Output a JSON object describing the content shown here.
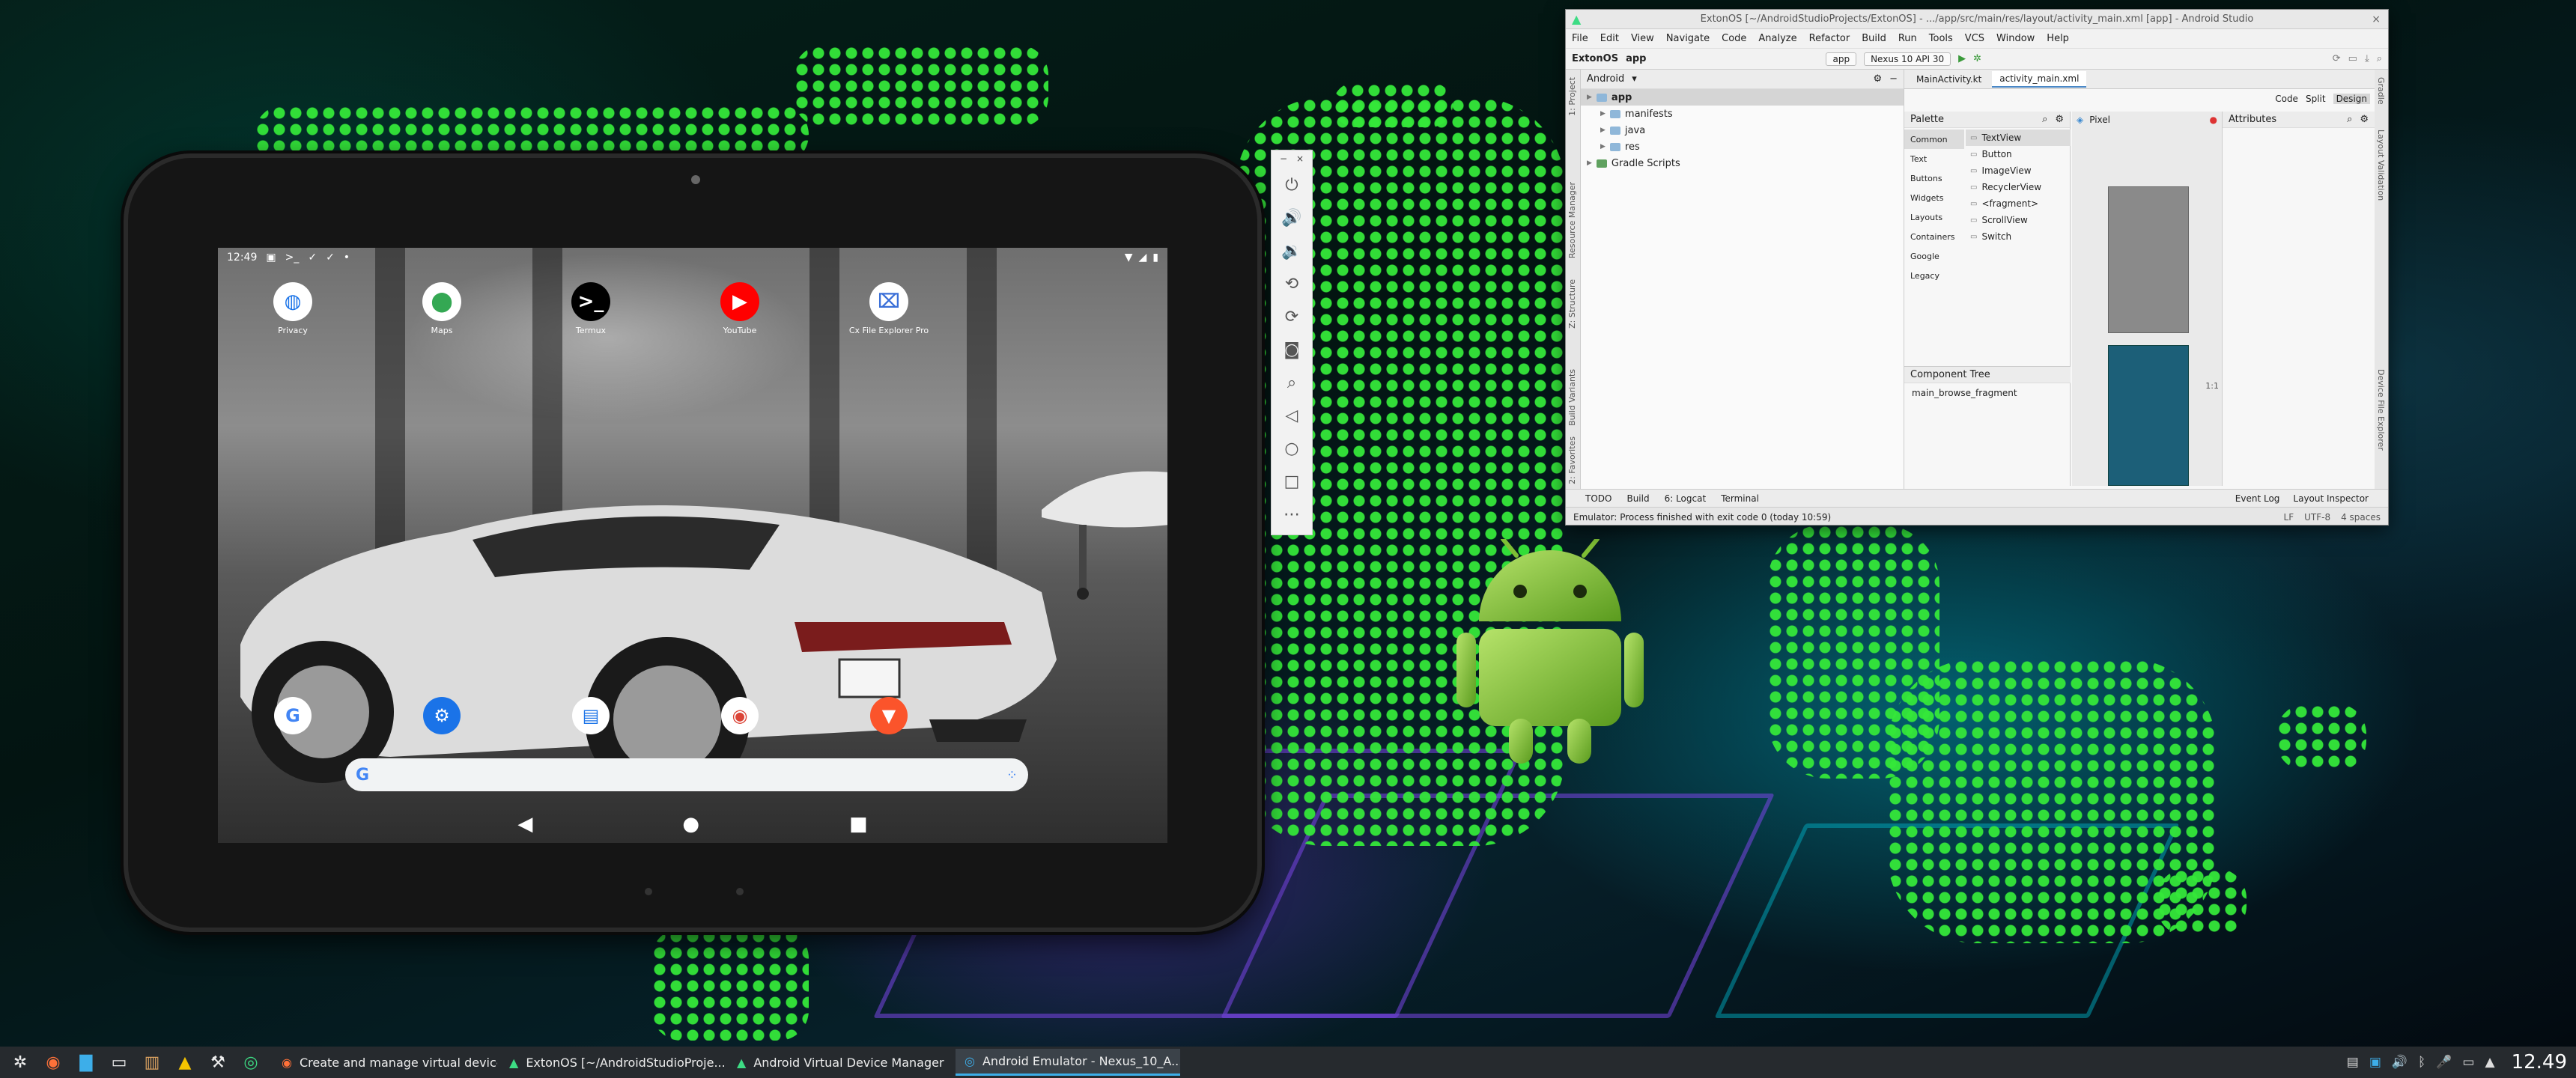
{
  "tablet": {
    "status": {
      "time": "12:49"
    },
    "apps": [
      {
        "label": "Privacy",
        "icon": "privacy-globe-icon",
        "glyph": "◍",
        "bg": "#ffffff",
        "fg": "#1a73e8"
      },
      {
        "label": "Maps",
        "icon": "maps-pin-icon",
        "glyph": "⬤",
        "bg": "#ffffff",
        "fg": "#34a853"
      },
      {
        "label": "Termux",
        "icon": "termux-terminal-icon",
        "glyph": ">_",
        "bg": "#000000",
        "fg": "#ffffff"
      },
      {
        "label": "YouTube",
        "icon": "youtube-play-icon",
        "glyph": "▶",
        "bg": "#ff0000",
        "fg": "#ffffff"
      },
      {
        "label": "Cx File Explorer Pro",
        "icon": "file-explorer-icon",
        "glyph": "⌧",
        "bg": "#ffffff",
        "fg": "#3a6fd8"
      }
    ],
    "dock": [
      {
        "icon": "google-g-icon",
        "glyph": "G",
        "bg": "#ffffff",
        "fg": "#4285f4"
      },
      {
        "icon": "settings-gear-icon",
        "glyph": "⚙",
        "bg": "#1a73e8",
        "fg": "#ffffff"
      },
      {
        "icon": "files-icon",
        "glyph": "▤",
        "bg": "#ffffff",
        "fg": "#1a73e8"
      },
      {
        "icon": "chrome-icon",
        "glyph": "◉",
        "bg": "#ffffff",
        "fg": "#db4437"
      },
      {
        "icon": "brave-browser-icon",
        "glyph": "▼",
        "bg": "#fb542b",
        "fg": "#ffffff"
      }
    ],
    "search": {
      "g_letter": "G"
    }
  },
  "emulator_toolbar": {
    "close": "×",
    "minimize": "−",
    "more": "⋯"
  },
  "studio": {
    "title": "ExtonOS [~/AndroidStudioProjects/ExtonOS] - .../app/src/main/res/layout/activity_main.xml [app] - Android Studio",
    "menu": [
      "File",
      "Edit",
      "View",
      "Navigate",
      "Code",
      "Analyze",
      "Refactor",
      "Build",
      "Run",
      "Tools",
      "VCS",
      "Window",
      "Help"
    ],
    "breadcrumb": [
      "ExtonOS",
      "app"
    ],
    "run_config": "app",
    "device": "Nexus 10 API 30",
    "left_stripe": [
      "1: Project",
      "Resource Manager",
      "Z: Structure",
      "Build Variants",
      "2: Favorites"
    ],
    "right_stripe": [
      "Gradle",
      "Layout Validation",
      "Device File Explorer"
    ],
    "project_view": "Android",
    "tree": [
      {
        "label": "app",
        "depth": 0,
        "bold": true,
        "selected": true
      },
      {
        "label": "manifests",
        "depth": 1
      },
      {
        "label": "java",
        "depth": 1
      },
      {
        "label": "res",
        "depth": 1
      },
      {
        "label": "Gradle Scripts",
        "depth": 0
      }
    ],
    "tabs": [
      "MainActivity.kt",
      "activity_main.xml"
    ],
    "modes": [
      "Code",
      "Split",
      "Design"
    ],
    "palette": {
      "title": "Palette",
      "categories": [
        "Common",
        "Text",
        "Buttons",
        "Widgets",
        "Layouts",
        "Containers",
        "Google",
        "Legacy"
      ],
      "items": [
        "TextView",
        "Button",
        "ImageView",
        "RecyclerView",
        "<fragment>",
        "ScrollView",
        "Switch"
      ]
    },
    "component_tree": {
      "title": "Component Tree",
      "root": "main_browse_fragment"
    },
    "design": {
      "device": "Pixel",
      "zoom": "1:1"
    },
    "attributes_title": "Attributes",
    "bottom_tabs": [
      "TODO",
      "Build",
      "6: Logcat",
      "Terminal"
    ],
    "bottom_right": [
      "Event Log",
      "Layout Inspector"
    ],
    "status_msg": "Emulator: Process finished with exit code 0 (today 10:59)",
    "status_right": [
      "LF",
      "UTF-8",
      "4 spaces"
    ]
  },
  "taskbar": {
    "tasks": [
      {
        "label": "Create and manage virtual devices ...",
        "icon": "firefox-icon",
        "glyph": "◉",
        "color": "#ff7139",
        "active": false
      },
      {
        "label": "ExtonOS [~/AndroidStudioProje...",
        "icon": "android-studio-icon",
        "glyph": "▲",
        "color": "#3ddc84",
        "active": false
      },
      {
        "label": "Android Virtual Device Manager",
        "icon": "avd-manager-icon",
        "glyph": "▲",
        "color": "#3ddc84",
        "active": false
      },
      {
        "label": "Android Emulator - Nexus_10_A...",
        "icon": "emulator-icon",
        "glyph": "◎",
        "color": "#3daee9",
        "active": true
      }
    ],
    "clock": "12.49"
  }
}
